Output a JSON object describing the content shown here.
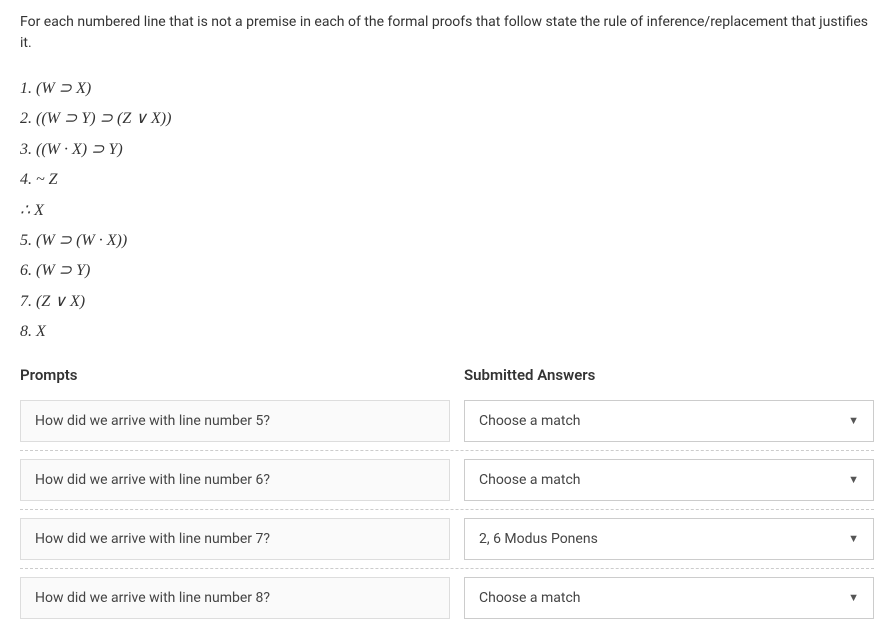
{
  "instructions": "For each numbered line that is not a premise in each of the formal proofs that follow state the rule of inference/replacement that justifies it.",
  "proof": {
    "lines": [
      "1. (W ⊃ X)",
      "2. ((W ⊃ Y) ⊃ (Z ∨ X))",
      "3. ((W · X) ⊃ Y)",
      "4. ~ Z",
      "∴ X",
      "5. (W ⊃ (W · X))",
      "6. (W ⊃ Y)",
      "7. (Z ∨ X)",
      "8. X"
    ]
  },
  "headers": {
    "prompts": "Prompts",
    "answers": "Submitted Answers"
  },
  "matches": [
    {
      "prompt": "How did we arrive with line number 5?",
      "answer": "Choose a match"
    },
    {
      "prompt": "How did we arrive with line number 6?",
      "answer": "Choose a match"
    },
    {
      "prompt": "How did we arrive with line number 7?",
      "answer": "2, 6 Modus Ponens"
    },
    {
      "prompt": "How did we arrive with line number 8?",
      "answer": "Choose a match"
    }
  ]
}
